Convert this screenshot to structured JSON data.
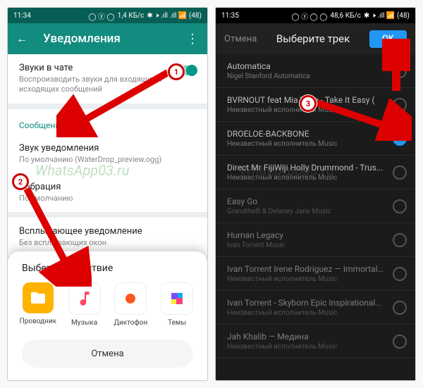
{
  "left": {
    "status": {
      "time": "11:34",
      "icons": "◯ ⓨ ◯",
      "net": "1,4 КБ/с",
      "sig": "✱ 🕨 .ıll .ıll 📶 (48)"
    },
    "appbar": {
      "title": "Уведомления"
    },
    "chatSounds": {
      "title": "Звуки в чате",
      "sub": "Воспроизводить звуки для входящих и исходящих сообщений"
    },
    "section": "Сообщения",
    "notifSound": {
      "title": "Звук уведомления",
      "sub": "По умолчанию (WaterDrop_preview.ogg)"
    },
    "vibration": {
      "title": "Вибрация",
      "sub": "По умолчанию"
    },
    "popup": {
      "title": "Всплывающее уведомление",
      "sub": "Без всплывающих окон"
    },
    "sheet": {
      "title": "Выберите действие",
      "apps": [
        "Проводник",
        "Музыка",
        "Диктофон",
        "Темы"
      ],
      "cancel": "Отмена"
    }
  },
  "right": {
    "status": {
      "time": "11:35",
      "icons": "◯ ⓨ ◯ ◯",
      "net": "48,6 КБ/с",
      "sig": "✱ 🕨 .ıll 📶 (48)"
    },
    "bar": {
      "cancel": "Отмена",
      "title": "Выберите трек",
      "ok": "OK"
    },
    "tracks": [
      {
        "a": "Automatica",
        "b": "Nigel Stanford Automatica",
        "sel": false
      },
      {
        "a": "BVRNOUT feat Mia Vaile - Take It Easy (",
        "b": "Неизвестный исполнитель Music",
        "sel": false
      },
      {
        "a": "DROELOE-BACKBONE",
        "b": "Неизвестный исполнитель Music",
        "sel": true
      },
      {
        "a": "Direct Mr FijiWiji Holly Drummond - Trus...",
        "b": "Неизвестный исполнитель Music",
        "sel": false
      },
      {
        "a": "Easy Go",
        "b": "Grandtheft & Delaney Jane Music",
        "sel": false
      },
      {
        "a": "Human Legacy",
        "b": "Ivan Torrent Music",
        "sel": false
      },
      {
        "a": "Ivan Torrent  Irene Rodriguez — Immortal...",
        "b": "Неизвестный исполнитель Music",
        "sel": false
      },
      {
        "a": "Ivan Torrent - Skyborn Epic Inspirational...",
        "b": "Неизвестный исполнитель Music",
        "sel": false
      },
      {
        "a": "Jah Khalib — Медина",
        "b": "Неизвестный исполнитель Music",
        "sel": false
      }
    ]
  },
  "watermark": "WhatsApp03.ru",
  "markers": {
    "m1": "1",
    "m2": "2",
    "m3": "3"
  },
  "appColors": [
    "#ffb300",
    "#ff4569",
    "#ff5722",
    "#7c4dff"
  ]
}
